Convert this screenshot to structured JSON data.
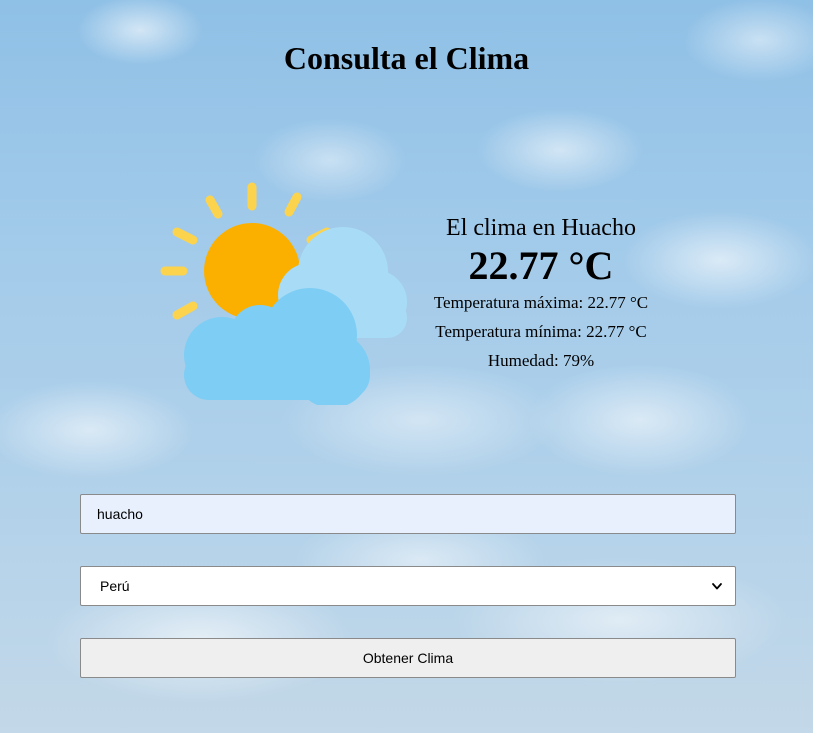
{
  "page": {
    "title": "Consulta el Clima"
  },
  "weather": {
    "icon": "sun-behind-clouds-icon",
    "city_line": "El clima en Huacho",
    "temperature": "22.77 °C",
    "max_temp": "Temperatura máxima: 22.77 °C",
    "min_temp": "Temperatura mínima: 22.77 °C",
    "humidity": "Humedad: 79%"
  },
  "form": {
    "city_value": "huacho",
    "country_selected": "Perú",
    "submit_label": "Obtener Clima"
  },
  "colors": {
    "sun": "#fbb000",
    "sun_rays": "#fcd34d",
    "cloud_back": "#a8dcf6",
    "cloud_front": "#7ecdf4",
    "input_autofill_bg": "#e8f0fe",
    "button_bg": "#efefef"
  }
}
